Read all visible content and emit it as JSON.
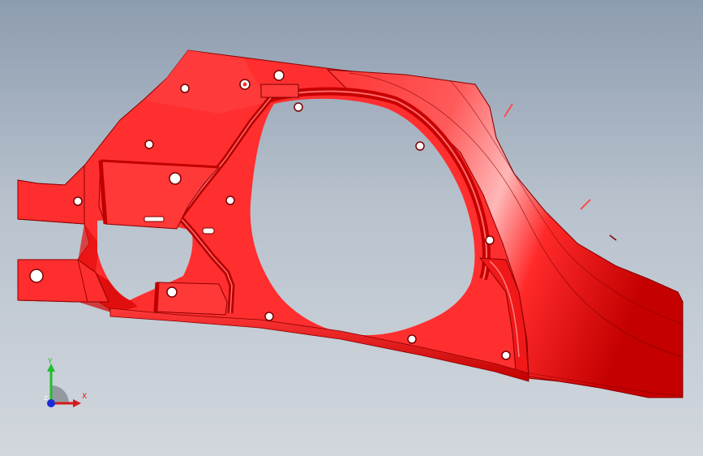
{
  "viewport": {
    "background_top": "#8d9caf",
    "background_bottom": "#d2d7dd"
  },
  "model": {
    "color": "#ff2e2e",
    "shade_color": "#c80000",
    "highlight_color": "#ffb3b3",
    "edge_color": "#7a0000"
  },
  "triad": {
    "x_label": "X",
    "y_label": "Y",
    "z_label": "Z",
    "x_color": "#d21b1b",
    "y_color": "#1fbf2a",
    "z_color": "#1a2bd6"
  }
}
